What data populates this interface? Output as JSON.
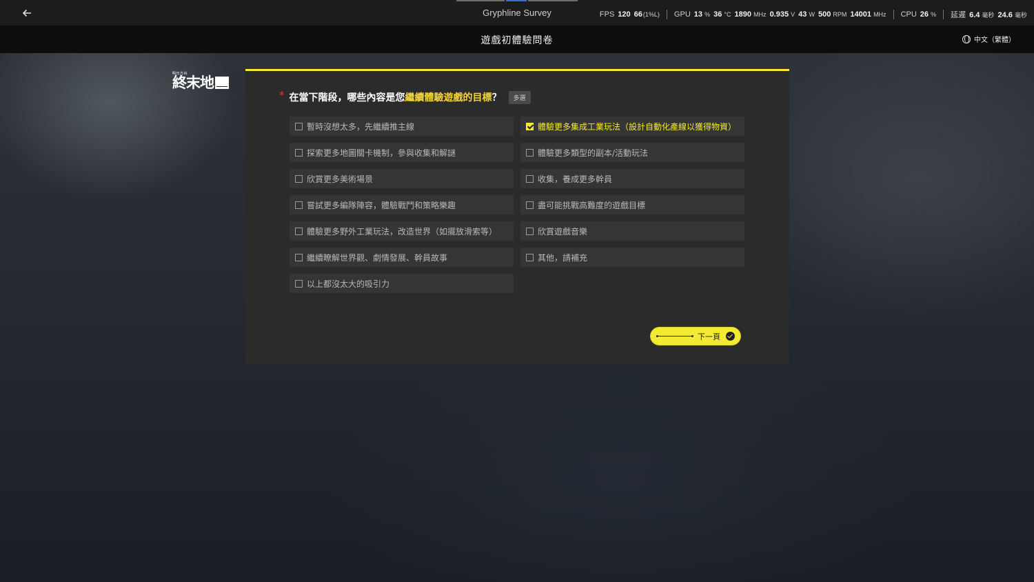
{
  "window": {
    "title": "Gryphline Survey",
    "back_icon": "arrow-left-icon"
  },
  "overlay": {
    "fps_label": "FPS",
    "fps_value": "120",
    "fps_low": "66",
    "fps_low_unit": "(1%L)",
    "gpu_label": "GPU",
    "gpu_usage": "13",
    "gpu_usage_unit": "%",
    "gpu_temp": "36",
    "gpu_temp_unit": "°C",
    "gpu_clock": "1890",
    "gpu_clock_unit": "MHz",
    "gpu_voltage": "0.935",
    "gpu_voltage_unit": "V",
    "gpu_power": "43",
    "gpu_power_unit": "W",
    "gpu_fan": "500",
    "gpu_fan_unit": "RPM",
    "mem_clock": "14001",
    "mem_clock_unit": "MHz",
    "cpu_label": "CPU",
    "cpu_usage": "26",
    "cpu_usage_unit": "%",
    "latency_label": "延遲",
    "latency_a": "6.4",
    "latency_a_unit": "毫秒",
    "latency_b": "24.6",
    "latency_b_unit": "毫秒"
  },
  "header": {
    "title": "遊戲初體驗問卷",
    "language": "中文（繁體）",
    "language_icon": "globe-icon"
  },
  "logo": {
    "text": "終末地",
    "sub": "明日方舟"
  },
  "question": {
    "required_mark": "*",
    "text_before": "在當下階段，哪些內容是您",
    "text_highlight": "繼續體驗遊戲的目標",
    "text_after": "？",
    "badge": "多選"
  },
  "options": [
    {
      "label": "暫時沒想太多，先繼續推主線",
      "checked": false
    },
    {
      "label": "體驗更多集成工業玩法（設計自動化產線以獲得物資）",
      "checked": true
    },
    {
      "label": "探索更多地圖關卡機制，參與收集和解謎",
      "checked": false
    },
    {
      "label": "體驗更多類型的副本/活動玩法",
      "checked": false
    },
    {
      "label": "欣賞更多美術場景",
      "checked": false
    },
    {
      "label": "收集，養成更多幹員",
      "checked": false
    },
    {
      "label": "嘗試更多編隊陣容，體驗戰鬥和策略樂趣",
      "checked": false
    },
    {
      "label": "盡可能挑戰高難度的遊戲目標",
      "checked": false
    },
    {
      "label": "體驗更多野外工業玩法，改造世界（如擺放滑索等）",
      "checked": false
    },
    {
      "label": "欣賞遊戲音樂",
      "checked": false
    },
    {
      "label": "繼續瞭解世界觀、劇情發展、幹員故事",
      "checked": false
    },
    {
      "label": "其他，請補充",
      "checked": false
    },
    {
      "label": "以上都沒太大的吸引力",
      "checked": false
    }
  ],
  "next_button": {
    "label": "下一頁",
    "icon": "check-circle-icon"
  },
  "colors": {
    "accent": "#f4ea33",
    "highlight_text": "#f4d43a",
    "required": "#e23a3a"
  }
}
